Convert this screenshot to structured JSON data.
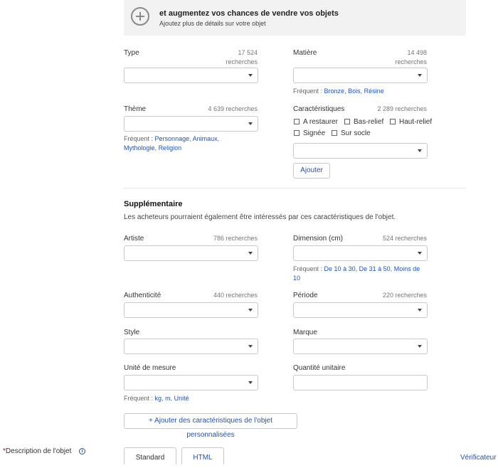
{
  "banner": {
    "title": "et augmentez vos chances de vendre vos objets",
    "subtitle": "Ajoutez plus de détails sur votre objet"
  },
  "fields": {
    "type": {
      "label": "Type",
      "count_line1": "17 524",
      "count_line2": "recherches"
    },
    "matiere": {
      "label": "Matière",
      "count_line1": "14 498",
      "count_line2": "recherches",
      "freq_label": "Fréquent :",
      "freq": [
        "Bronze",
        "Bois",
        "Résine"
      ]
    },
    "theme": {
      "label": "Thème",
      "count": "4 639 recherches",
      "freq_label": "Fréquent :",
      "freq": [
        "Personnage",
        "Animaux",
        "Mythologie",
        "Religion"
      ]
    },
    "caracteristiques": {
      "label": "Caractéristiques",
      "count": "2 289 recherches",
      "options": [
        "A restaurer",
        "Bas-relief",
        "Haut-relief",
        "Signée",
        "Sur socle"
      ],
      "add_button": "Ajouter"
    },
    "artiste": {
      "label": "Artiste",
      "count": "786 recherches"
    },
    "dimension": {
      "label": "Dimension (cm)",
      "count": "524 recherches",
      "freq_label": "Fréquent :",
      "freq": [
        "De 10 à 30",
        "De 31 à 50",
        "Moins de",
        "10"
      ]
    },
    "authenticite": {
      "label": "Authenticité",
      "count": "440 recherches"
    },
    "periode": {
      "label": "Période",
      "count": "220 recherches"
    },
    "style": {
      "label": "Style"
    },
    "marque": {
      "label": "Marque"
    },
    "unite": {
      "label": "Unité de mesure",
      "freq_label": "Fréquent :",
      "freq": [
        "kg",
        "m",
        "Unité"
      ]
    },
    "quantite": {
      "label": "Quantité unitaire"
    }
  },
  "supplementaire": {
    "title": "Supplémentaire",
    "description": "Les acheteurs pourraient également être intéressés par ces caractéristiques de l'objet."
  },
  "custom_button": "+ Ajouter des caractéristiques de l'objet personnalisées",
  "description": {
    "required_mark": "*",
    "label": "Description de l'objet",
    "tabs": [
      "Standard",
      "HTML"
    ],
    "right_link": "Vérificateur d"
  },
  "sep": ",",
  "colors": {
    "link": "#2153b7",
    "required": "#cc0000"
  }
}
